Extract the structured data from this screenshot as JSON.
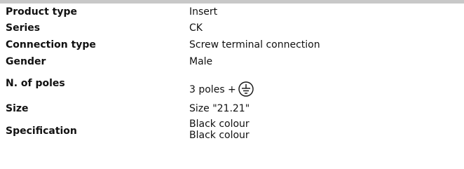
{
  "spec_rows": {
    "product_type": {
      "label": "Product type",
      "value": "Insert"
    },
    "series": {
      "label": "Series",
      "value": "CK"
    },
    "connection_type": {
      "label": "Connection type",
      "value": "Screw terminal connection"
    },
    "gender": {
      "label": "Gender",
      "value": "Male"
    },
    "poles": {
      "label": "N. of poles",
      "value": "3 poles +",
      "icon": "ground-icon"
    },
    "size": {
      "label": "Size",
      "value": "Size \"21.21\""
    },
    "specification": {
      "label": "Specification",
      "values": [
        "Black colour",
        "Black colour"
      ]
    }
  },
  "colors": {
    "header_strip": "#c8c8c8",
    "text": "#111111",
    "background": "#ffffff"
  }
}
